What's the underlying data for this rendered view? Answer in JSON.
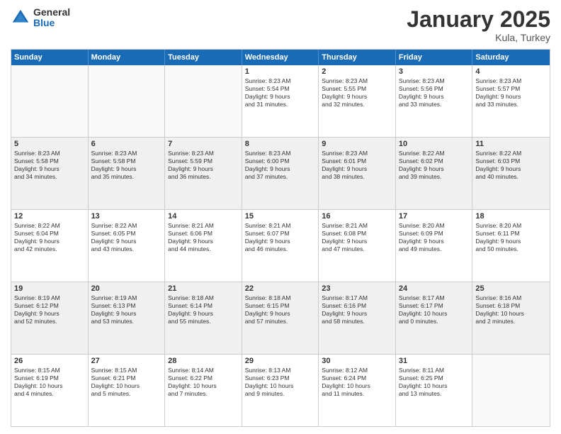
{
  "logo": {
    "general": "General",
    "blue": "Blue"
  },
  "header": {
    "month": "January 2025",
    "location": "Kula, Turkey"
  },
  "weekdays": [
    "Sunday",
    "Monday",
    "Tuesday",
    "Wednesday",
    "Thursday",
    "Friday",
    "Saturday"
  ],
  "rows": [
    [
      {
        "day": "",
        "text": ""
      },
      {
        "day": "",
        "text": ""
      },
      {
        "day": "",
        "text": ""
      },
      {
        "day": "1",
        "text": "Sunrise: 8:23 AM\nSunset: 5:54 PM\nDaylight: 9 hours\nand 31 minutes."
      },
      {
        "day": "2",
        "text": "Sunrise: 8:23 AM\nSunset: 5:55 PM\nDaylight: 9 hours\nand 32 minutes."
      },
      {
        "day": "3",
        "text": "Sunrise: 8:23 AM\nSunset: 5:56 PM\nDaylight: 9 hours\nand 33 minutes."
      },
      {
        "day": "4",
        "text": "Sunrise: 8:23 AM\nSunset: 5:57 PM\nDaylight: 9 hours\nand 33 minutes."
      }
    ],
    [
      {
        "day": "5",
        "text": "Sunrise: 8:23 AM\nSunset: 5:58 PM\nDaylight: 9 hours\nand 34 minutes."
      },
      {
        "day": "6",
        "text": "Sunrise: 8:23 AM\nSunset: 5:58 PM\nDaylight: 9 hours\nand 35 minutes."
      },
      {
        "day": "7",
        "text": "Sunrise: 8:23 AM\nSunset: 5:59 PM\nDaylight: 9 hours\nand 36 minutes."
      },
      {
        "day": "8",
        "text": "Sunrise: 8:23 AM\nSunset: 6:00 PM\nDaylight: 9 hours\nand 37 minutes."
      },
      {
        "day": "9",
        "text": "Sunrise: 8:23 AM\nSunset: 6:01 PM\nDaylight: 9 hours\nand 38 minutes."
      },
      {
        "day": "10",
        "text": "Sunrise: 8:22 AM\nSunset: 6:02 PM\nDaylight: 9 hours\nand 39 minutes."
      },
      {
        "day": "11",
        "text": "Sunrise: 8:22 AM\nSunset: 6:03 PM\nDaylight: 9 hours\nand 40 minutes."
      }
    ],
    [
      {
        "day": "12",
        "text": "Sunrise: 8:22 AM\nSunset: 6:04 PM\nDaylight: 9 hours\nand 42 minutes."
      },
      {
        "day": "13",
        "text": "Sunrise: 8:22 AM\nSunset: 6:05 PM\nDaylight: 9 hours\nand 43 minutes."
      },
      {
        "day": "14",
        "text": "Sunrise: 8:21 AM\nSunset: 6:06 PM\nDaylight: 9 hours\nand 44 minutes."
      },
      {
        "day": "15",
        "text": "Sunrise: 8:21 AM\nSunset: 6:07 PM\nDaylight: 9 hours\nand 46 minutes."
      },
      {
        "day": "16",
        "text": "Sunrise: 8:21 AM\nSunset: 6:08 PM\nDaylight: 9 hours\nand 47 minutes."
      },
      {
        "day": "17",
        "text": "Sunrise: 8:20 AM\nSunset: 6:09 PM\nDaylight: 9 hours\nand 49 minutes."
      },
      {
        "day": "18",
        "text": "Sunrise: 8:20 AM\nSunset: 6:11 PM\nDaylight: 9 hours\nand 50 minutes."
      }
    ],
    [
      {
        "day": "19",
        "text": "Sunrise: 8:19 AM\nSunset: 6:12 PM\nDaylight: 9 hours\nand 52 minutes."
      },
      {
        "day": "20",
        "text": "Sunrise: 8:19 AM\nSunset: 6:13 PM\nDaylight: 9 hours\nand 53 minutes."
      },
      {
        "day": "21",
        "text": "Sunrise: 8:18 AM\nSunset: 6:14 PM\nDaylight: 9 hours\nand 55 minutes."
      },
      {
        "day": "22",
        "text": "Sunrise: 8:18 AM\nSunset: 6:15 PM\nDaylight: 9 hours\nand 57 minutes."
      },
      {
        "day": "23",
        "text": "Sunrise: 8:17 AM\nSunset: 6:16 PM\nDaylight: 9 hours\nand 58 minutes."
      },
      {
        "day": "24",
        "text": "Sunrise: 8:17 AM\nSunset: 6:17 PM\nDaylight: 10 hours\nand 0 minutes."
      },
      {
        "day": "25",
        "text": "Sunrise: 8:16 AM\nSunset: 6:18 PM\nDaylight: 10 hours\nand 2 minutes."
      }
    ],
    [
      {
        "day": "26",
        "text": "Sunrise: 8:15 AM\nSunset: 6:19 PM\nDaylight: 10 hours\nand 4 minutes."
      },
      {
        "day": "27",
        "text": "Sunrise: 8:15 AM\nSunset: 6:21 PM\nDaylight: 10 hours\nand 5 minutes."
      },
      {
        "day": "28",
        "text": "Sunrise: 8:14 AM\nSunset: 6:22 PM\nDaylight: 10 hours\nand 7 minutes."
      },
      {
        "day": "29",
        "text": "Sunrise: 8:13 AM\nSunset: 6:23 PM\nDaylight: 10 hours\nand 9 minutes."
      },
      {
        "day": "30",
        "text": "Sunrise: 8:12 AM\nSunset: 6:24 PM\nDaylight: 10 hours\nand 11 minutes."
      },
      {
        "day": "31",
        "text": "Sunrise: 8:11 AM\nSunset: 6:25 PM\nDaylight: 10 hours\nand 13 minutes."
      },
      {
        "day": "",
        "text": ""
      }
    ]
  ]
}
